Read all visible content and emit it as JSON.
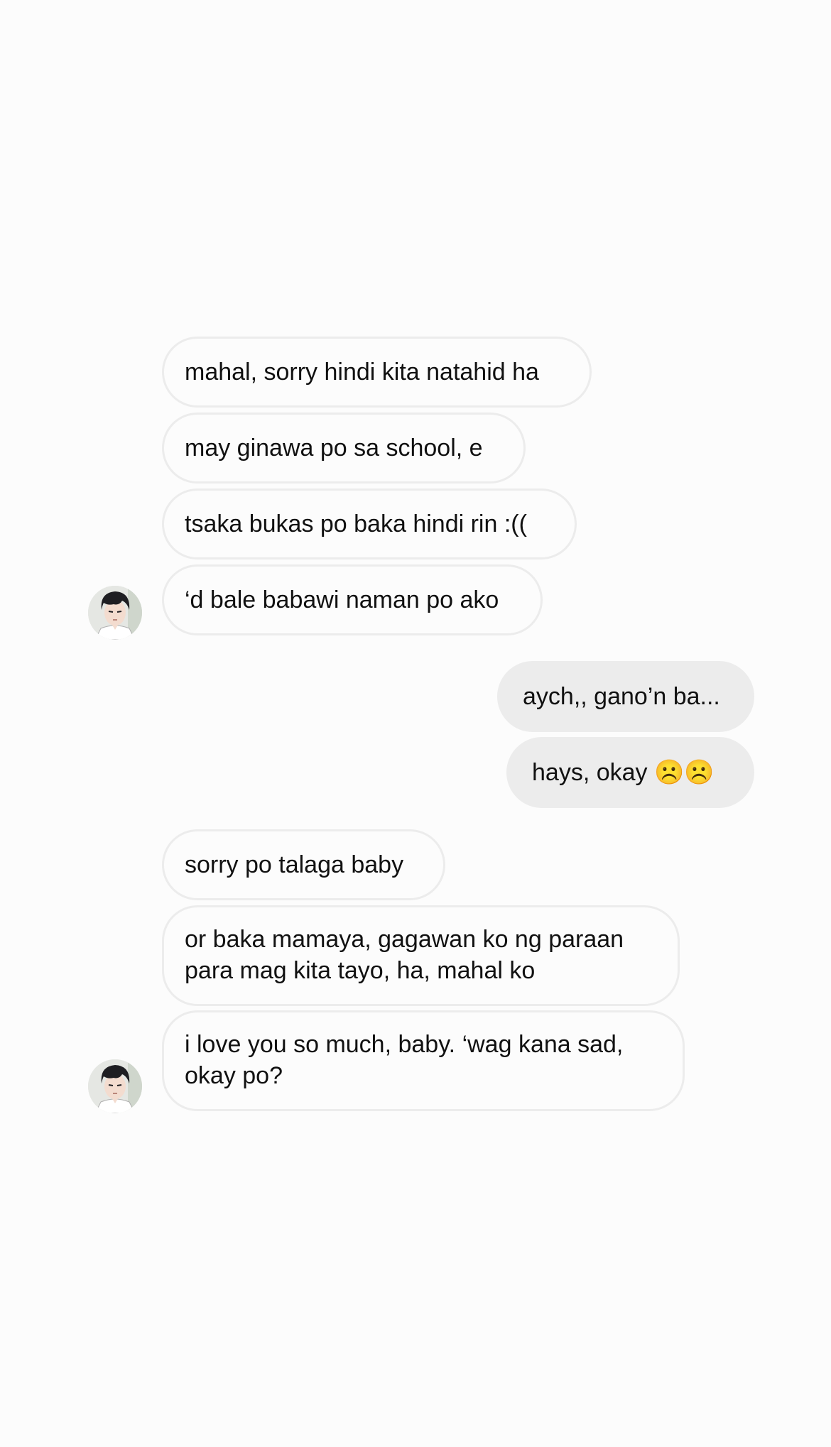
{
  "conversation": {
    "messages": [
      {
        "from": "them",
        "text": "mahal, sorry hindi kita natahid ha"
      },
      {
        "from": "them",
        "text": "may ginawa po sa school, e"
      },
      {
        "from": "them",
        "text": "tsaka bukas po baka hindi rin :(("
      },
      {
        "from": "them",
        "text": "‘d bale babawi naman po ako"
      },
      {
        "from": "me",
        "text": "aych,, gano’n ba..."
      },
      {
        "from": "me",
        "text": "hays, okay ☹️☹️"
      },
      {
        "from": "them",
        "text": "sorry po talaga baby"
      },
      {
        "from": "them",
        "text": "or baka mamaya, gagawan ko ng paraan para mag kita tayo, ha, mahal ko"
      },
      {
        "from": "them",
        "text": "i love you so much, baby. ‘wag kana sad, okay po?"
      }
    ]
  },
  "avatar": {
    "icon": "anime-boy-avatar-icon",
    "colors": {
      "background": "#e5e7e3",
      "hair": "#1e1e22",
      "skin": "#f3dccf",
      "shirt": "#ffffff"
    }
  },
  "colors": {
    "page_background": "#fcfcfc",
    "incoming_border": "#ececec",
    "outgoing_bubble": "#ececec",
    "text": "#111111"
  }
}
